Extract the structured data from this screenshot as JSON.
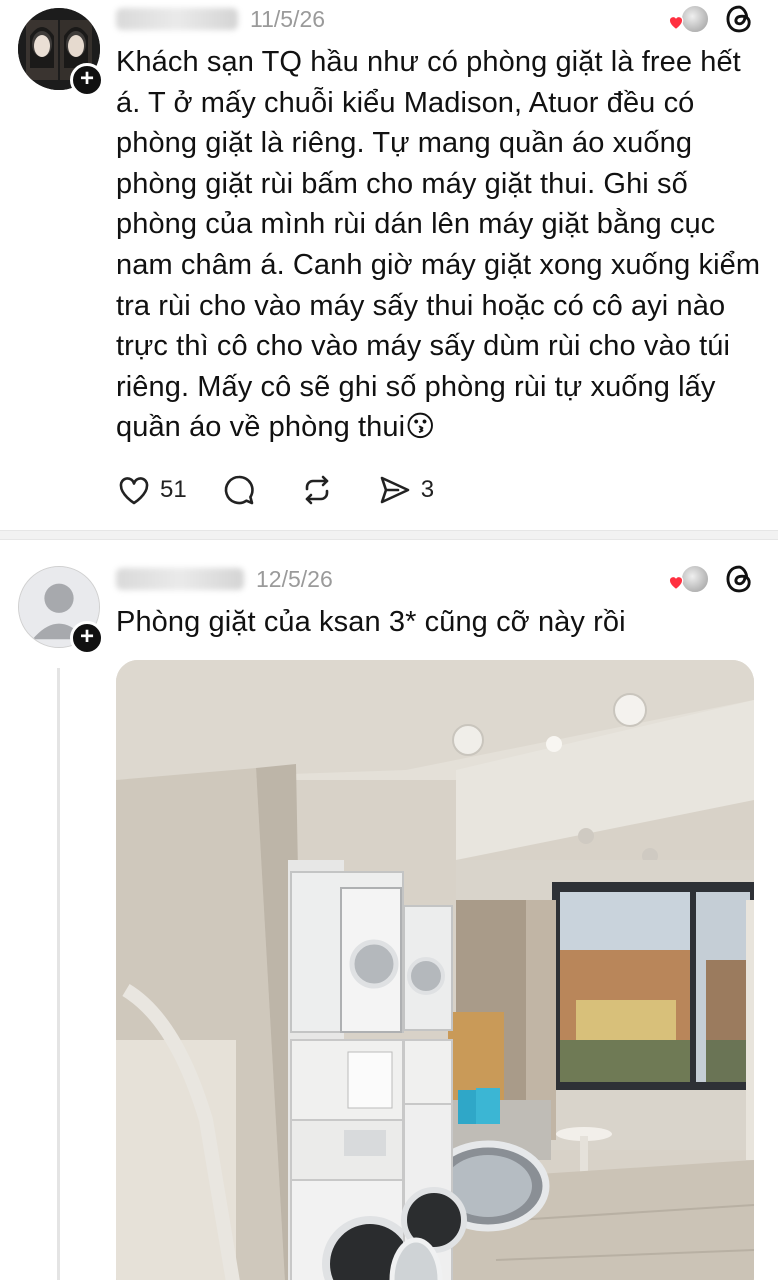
{
  "posts": [
    {
      "date": "11/5/26",
      "text": "Khách sạn TQ hầu như có phòng giặt là free hết á. T ở mấy chuỗi kiểu Madison, Atuor đều có phòng giặt là riêng. Tự mang quần áo xuống phòng giặt rùi bấm cho máy giặt thui. Ghi số phòng của mình rùi dán lên máy giặt bằng cục nam châm á. Canh giờ máy giặt xong xuống kiểm tra rùi cho vào máy sấy thui hoặc có cô ayi nào trực thì cô cho vào máy sấy dùm rùi cho vào túi riêng. Mấy cô sẽ ghi số phòng rùi tự xuống lấy quần áo về phòng thui😗",
      "actions": {
        "like_count": "51",
        "share_count": "3"
      }
    },
    {
      "date": "12/5/26",
      "text": "Phòng giặt của ksan 3* cũng cỡ này rồi"
    }
  ],
  "icons": {
    "like": "heart-outline-icon",
    "reply": "speech-bubble-icon",
    "repost": "repost-arrows-icon",
    "share": "paper-plane-icon",
    "app": "threads-logo-icon",
    "follow": "plus-icon"
  },
  "colors": {
    "heart_red": "#ff3040",
    "meta_gray": "#9a9a9a",
    "text": "#111111"
  }
}
